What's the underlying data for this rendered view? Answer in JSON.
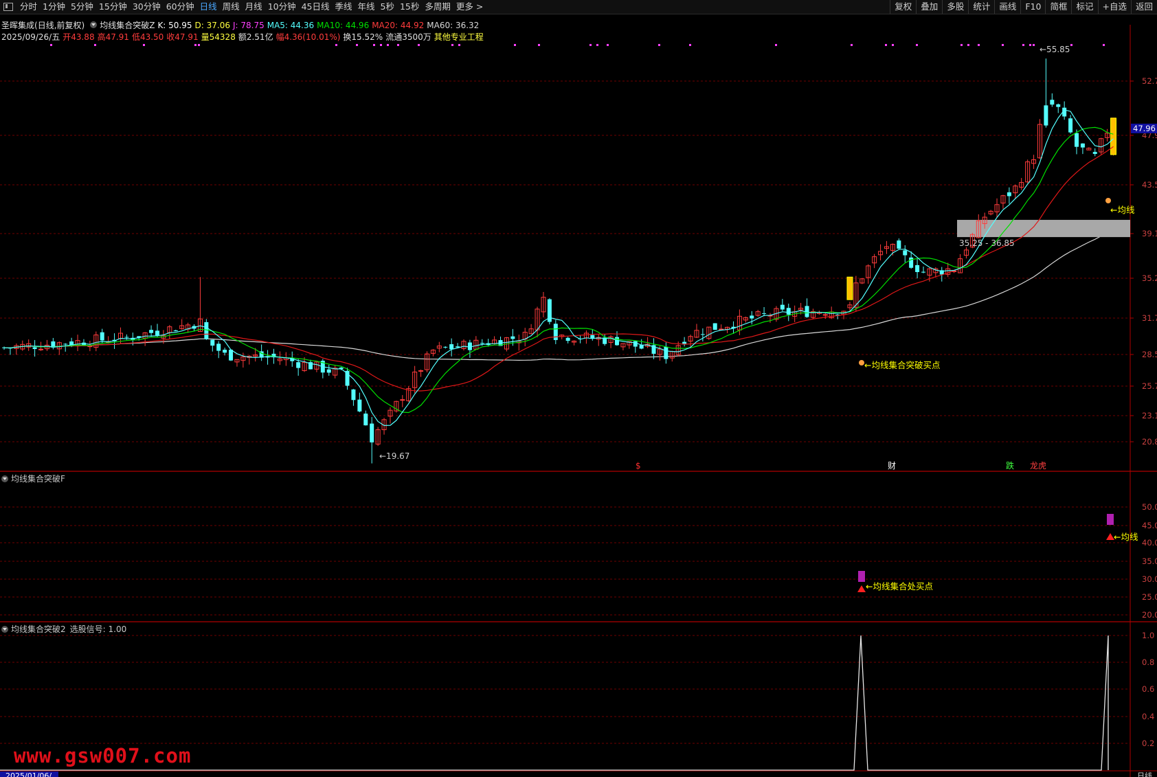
{
  "toolbar": {
    "periods": [
      "分时",
      "1分钟",
      "5分钟",
      "15分钟",
      "30分钟",
      "60分钟",
      "日线",
      "周线",
      "月线",
      "10分钟",
      "45日线",
      "季线",
      "年线",
      "5秒",
      "15秒",
      "多周期",
      "更多 >"
    ],
    "active": "日线",
    "right": [
      "复权",
      "叠加",
      "多股",
      "统计",
      "画线",
      "F10",
      "简框",
      "标记",
      "+自选",
      "返回"
    ]
  },
  "header": {
    "line1": {
      "name": "圣晖集成",
      "mode": "(日线,前复权)",
      "indicator": "均线集合突破Z",
      "k": "K: 50.95",
      "d": "D: 37.06",
      "j": "J: 78.75",
      "ma5": "MA5: 44.36",
      "ma10": "MA10: 44.96",
      "ma20": "MA20: 44.92",
      "ma60": "MA60: 36.32"
    },
    "line2": {
      "date": "2025/09/26/五",
      "open": "开43.88",
      "high": "高47.91",
      "low": "低43.50",
      "close": "收47.91",
      "volume": "量54328",
      "amount": "额2.51亿",
      "change": "幅4.36(10.01%)",
      "turnover": "换15.52%",
      "float": "流通3500万",
      "sector": "其他专业工程"
    }
  },
  "colors": {
    "up": "#ff3c3c",
    "down": "#54ffff",
    "ma5": "#54ffff",
    "ma10": "#00e000",
    "ma20": "#e01818",
    "ma60": "#d8d8d8",
    "label": "#ffff00",
    "signal": "#b020b0",
    "grid": "#700000"
  },
  "main_chart": {
    "y_ticks": [
      "52.7",
      "47.9",
      "43.5",
      "39.1",
      "35.2",
      "31.7",
      "28.5",
      "25.7",
      "23.1",
      "20.8"
    ],
    "price_tag": "47.96",
    "high_label": "55.85",
    "low_label": "19.67",
    "zone_label": "35.25 - 36.85",
    "buy_label": "均线集合突破买点",
    "buy_label_2": "均线",
    "events": [
      "$",
      "财",
      "跌",
      "龙虎"
    ]
  },
  "panel1": {
    "title": "均线集合突破F",
    "y_ticks": [
      "50.0",
      "45.0",
      "40.0",
      "35.0",
      "30.0",
      "25.0",
      "20.0"
    ],
    "label": "均线集合处买点",
    "label_2": "均线"
  },
  "panel2": {
    "title": "均线集合突破2",
    "signal_label": "选股信号: 1.00",
    "y_ticks": [
      "1.0",
      "0.8",
      "0.6",
      "0.4",
      "0.2"
    ]
  },
  "footer": {
    "date": "2025/01/06/",
    "right": "日线"
  },
  "watermark": "www.gsw007.com",
  "chart_data": {
    "type": "line",
    "signal_values": {
      "peak_1": 1.0,
      "peak_2": 1.0
    },
    "price_range": [
      19.67,
      55.85
    ]
  }
}
